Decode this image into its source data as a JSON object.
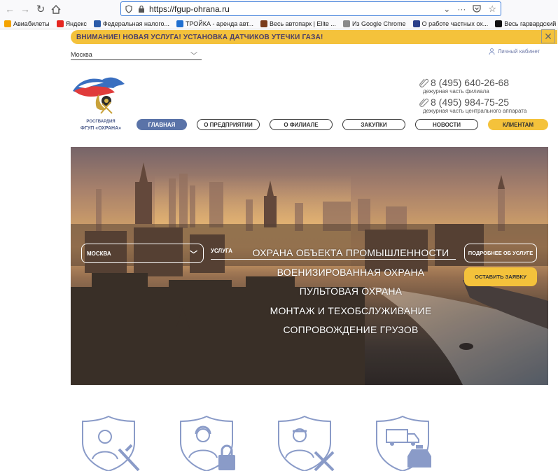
{
  "browser": {
    "url": "https://fgup-ohrana.ru",
    "bookmarks": [
      {
        "label": "Авиабилеты",
        "color": "#f4a300"
      },
      {
        "label": "Яндекс",
        "color": "#e52620"
      },
      {
        "label": "Федеральная налого...",
        "color": "#2a5aa8"
      },
      {
        "label": "ТРОЙКА - аренда авт...",
        "color": "#1f6fd0"
      },
      {
        "label": "Весь автопарк | Elite ...",
        "color": "#7a3c1c"
      },
      {
        "label": "Из Google Chrome",
        "color": "#8a8a8a"
      },
      {
        "label": "О работе частных ох...",
        "color": "#2a3f8a"
      },
      {
        "label": "Весь гарвардский кур...",
        "color": "#111111"
      }
    ]
  },
  "alert": {
    "text": "ВНИМАНИЕ! НОВАЯ УСЛУГА! УСТАНОВКА ДАТЧИКОВ УТЕЧКИ ГАЗА!",
    "close": "✕"
  },
  "header": {
    "city": "Москва",
    "cabinet": "Личный кабинет",
    "logo_line1": "РОСГВАРДИЯ",
    "logo_line2": "ФГУП «ОХРАНА»",
    "phones": [
      {
        "number": "8 (495) 640-26-68",
        "note": "дежурная часть филиала"
      },
      {
        "number": "8 (495) 984-75-25",
        "note": "дежурная часть центрального аппарата"
      }
    ]
  },
  "nav": [
    {
      "label": "ГЛАВНАЯ",
      "width": 72
    },
    {
      "label": "О ПРЕДПРИЯТИИ",
      "width": 90
    },
    {
      "label": "О ФИЛИАЛЕ",
      "width": 90
    },
    {
      "label": "ЗАКУПКИ",
      "width": 90
    },
    {
      "label": "НОВОСТИ",
      "width": 90
    },
    {
      "label": "КЛИЕНТАМ",
      "width": 86
    }
  ],
  "hero": {
    "city": "МОСКВА",
    "service_label": "УСЛУГА",
    "services": [
      "ОХРАНА ОБЪЕКТА ПРОМЫШЛЕННОСТИ",
      "ВОЕНИЗИРОВАННАЯ ОХРАНА",
      "ПУЛЬТОВАЯ ОХРАНА",
      "МОНТАЖ И ТЕХОБСЛУЖИВАНИЕ",
      "СОПРОВОЖДЕНИЕ ГРУЗОВ"
    ],
    "btn_more": "ПОДРОБНЕЕ ОБ УСЛУГЕ",
    "btn_order": "ОСТАВИТЬ ЗАЯВКУ"
  },
  "colors": {
    "accent_yellow": "#f4c23b",
    "accent_blue": "#5a73a8",
    "icon_blue": "#8a9bc8"
  },
  "features": [
    {
      "icon": "armed-guard-icon"
    },
    {
      "icon": "operator-lock-icon"
    },
    {
      "icon": "technician-tools-icon"
    },
    {
      "icon": "cargo-escort-icon"
    }
  ]
}
